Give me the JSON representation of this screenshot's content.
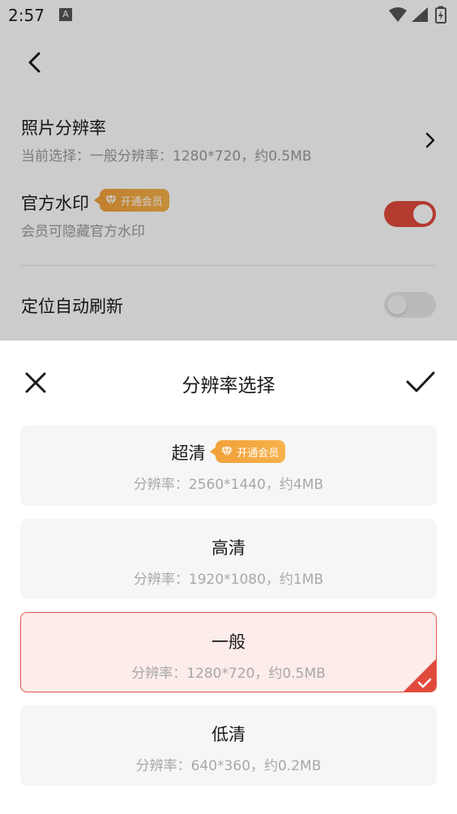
{
  "status_bar": {
    "time": "2:57",
    "notif_icon": "A"
  },
  "settings": {
    "resolution": {
      "title": "照片分辨率",
      "subtitle": "当前选择：一般分辨率：1280*720，约0.5MB"
    },
    "watermark": {
      "title": "官方水印",
      "badge": "开通会员",
      "subtitle": "会员可隐藏官方水印",
      "toggle_on": true
    },
    "location_refresh": {
      "title": "定位自动刷新",
      "toggle_on": false
    }
  },
  "sheet": {
    "title": "分辨率选择",
    "options": [
      {
        "title": "超清",
        "badge": "开通会员",
        "subtitle": "分辨率：2560*1440，约4MB",
        "selected": false
      },
      {
        "title": "高清",
        "subtitle": "分辨率：1920*1080，约1MB",
        "selected": false
      },
      {
        "title": "一般",
        "subtitle": "分辨率：1280*720，约0.5MB",
        "selected": true
      },
      {
        "title": "低清",
        "subtitle": "分辨率：640*360，约0.2MB",
        "selected": false
      }
    ]
  },
  "colors": {
    "accent": "#e04a3c",
    "vip": "#f2a13a",
    "selected_bg": "#fcecea"
  }
}
